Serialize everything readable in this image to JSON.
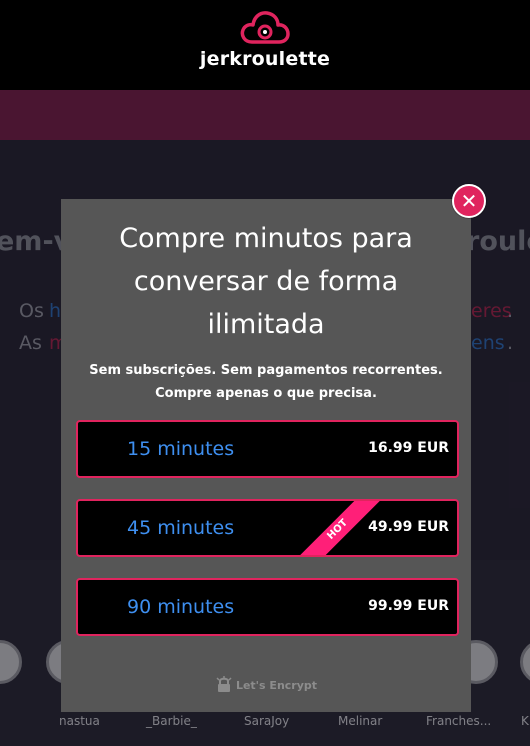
{
  "header": {
    "logo_text": "jerkroulette"
  },
  "background": {
    "heading_left": "em-vi",
    "heading_right": "roulette",
    "line1_left": "Os",
    "line1_left_accent": "h",
    "line1_right_accent": "eres",
    "line1_right": ".",
    "line2_left": "As",
    "line2_left_accent": "m",
    "line2_right_accent": "ens",
    "line2_right": ".",
    "users": [
      "nastua",
      "_Barbie_",
      "SaraJoy",
      "Melinar",
      "Franches...",
      "K"
    ]
  },
  "modal": {
    "title_lines": [
      "Compre minutos para",
      "conversar de forma",
      "ilimitada"
    ],
    "subtitle_lines": [
      "Sem subscrições. Sem pagamentos recorrentes.",
      "Compre apenas o que precisa."
    ],
    "plans": [
      {
        "label": "15 minutes",
        "price": "16.99 EUR"
      },
      {
        "label": "45 minutes",
        "price": "49.99 EUR",
        "badge": "HOT"
      },
      {
        "label": "90 minutes",
        "price": "99.99 EUR"
      }
    ],
    "security_badge": "Let's Encrypt"
  },
  "colors": {
    "accent": "#e0245e",
    "plan_label": "#3e8ff0",
    "modal_bg": "#565656",
    "header_bg": "#000000",
    "hot_badge": "#ff1f78"
  },
  "icons": [
    "cloud-logo-icon",
    "close-icon",
    "padlock-icon"
  ]
}
